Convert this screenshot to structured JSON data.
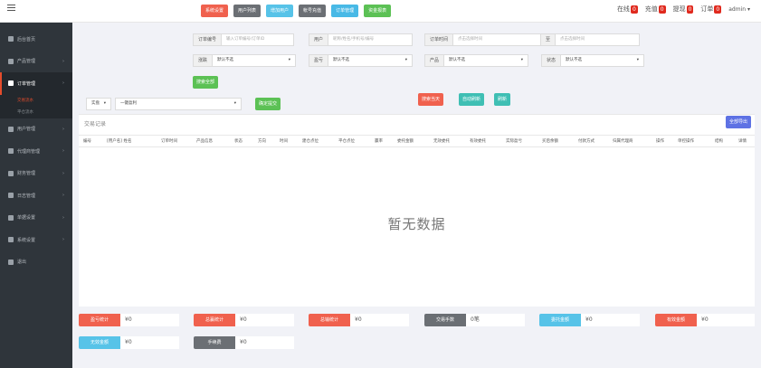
{
  "topbar": {
    "buttons": [
      {
        "label": "系统设置",
        "color": "#f0614e"
      },
      {
        "label": "用户列表",
        "color": "#6b6f74"
      },
      {
        "label": "增加用户",
        "color": "#57c3e8"
      },
      {
        "label": "帐号充值",
        "color": "#6b6f74"
      },
      {
        "label": "订单管理",
        "color": "#48b9e6"
      },
      {
        "label": "资金报表",
        "color": "#5cc155"
      }
    ],
    "stats": [
      {
        "label": "在线",
        "count": "0"
      },
      {
        "label": "充值",
        "count": "0"
      },
      {
        "label": "提现",
        "count": "0"
      },
      {
        "label": "订单",
        "count": "0"
      }
    ],
    "user": "admin",
    "user_caret": "▾"
  },
  "sidebar": {
    "items": [
      {
        "label": "后台首页",
        "icon": "dashboard-icon",
        "arrow": ""
      },
      {
        "label": "产品管理",
        "icon": "product-icon",
        "arrow": "›"
      },
      {
        "label": "订单管理",
        "icon": "order-icon",
        "arrow": "›",
        "active": true
      },
      {
        "label": "用户管理",
        "icon": "user-icon",
        "arrow": "›"
      },
      {
        "label": "代理商管理",
        "icon": "agent-icon",
        "arrow": "›"
      },
      {
        "label": "财务管理",
        "icon": "finance-icon",
        "arrow": "›"
      },
      {
        "label": "日志管理",
        "icon": "log-icon",
        "arrow": "›"
      },
      {
        "label": "单据设置",
        "icon": "doc-icon",
        "arrow": "›"
      },
      {
        "label": "系统设置",
        "icon": "settings-icon",
        "arrow": "›"
      },
      {
        "label": "退出",
        "icon": "logout-icon",
        "arrow": ""
      }
    ],
    "subitems": [
      "交易流水",
      "平仓流水"
    ]
  },
  "filters": {
    "order_no_label": "订单编号",
    "order_no_placeholder": "输入订单编号/订单ID",
    "user_label": "用户",
    "user_placeholder": "昵称/姓名/手机号/编号",
    "time_label": "订单时间",
    "time_from_placeholder": "点击选择时间",
    "time_to_label": "至",
    "time_to_placeholder": "点击选择时间",
    "direction_label": "涨跌",
    "direction_value": "默认不选",
    "profit_label": "盈亏",
    "profit_value": "默认不选",
    "product_label": "产品",
    "product_value": "默认不选",
    "status_label": "状态",
    "status_value": "默认不选",
    "caret": "▾",
    "search_button": "搜索全部"
  },
  "bulk": {
    "select_value": "实盘",
    "action_value": "一键盈利",
    "caret": "▾",
    "submit": "确定提交",
    "buttons": [
      {
        "label": "搜索当天",
        "color": "#f0614e"
      },
      {
        "label": "自动刷新",
        "color": "#3fbfb4"
      },
      {
        "label": "刷新",
        "color": "#3fbfb4"
      }
    ]
  },
  "table": {
    "title": "交易记录",
    "export_button": "全部导出",
    "columns": [
      "编号",
      "[用户名] 姓名",
      "订单时间",
      "产品信息",
      "状态",
      "方向",
      "时间",
      "建仓点位",
      "平仓点位",
      "赢率",
      "委托金额",
      "无效委托",
      "有效委托",
      "实际盈亏",
      "买后余额",
      "付款方式",
      "归属代理商",
      "操作",
      "单控操作",
      "结构",
      "详情"
    ],
    "empty": "暂无数据"
  },
  "summary": [
    {
      "label": "盈亏统计",
      "value": "¥0",
      "color": "#f0614e"
    },
    {
      "label": "总赢统计",
      "value": "¥0",
      "color": "#f0614e"
    },
    {
      "label": "总输统计",
      "value": "¥0",
      "color": "#f0614e"
    },
    {
      "label": "交易手数",
      "value": "0笔",
      "color": "#6b6f74"
    },
    {
      "label": "委托金额",
      "value": "¥0",
      "color": "#57c3e8"
    },
    {
      "label": "有效金额",
      "value": "¥0",
      "color": "#f0614e"
    },
    {
      "label": "无效金额",
      "value": "¥0",
      "color": "#57c3e8"
    },
    {
      "label": "手续费",
      "value": "¥0",
      "color": "#6b6f74"
    }
  ]
}
